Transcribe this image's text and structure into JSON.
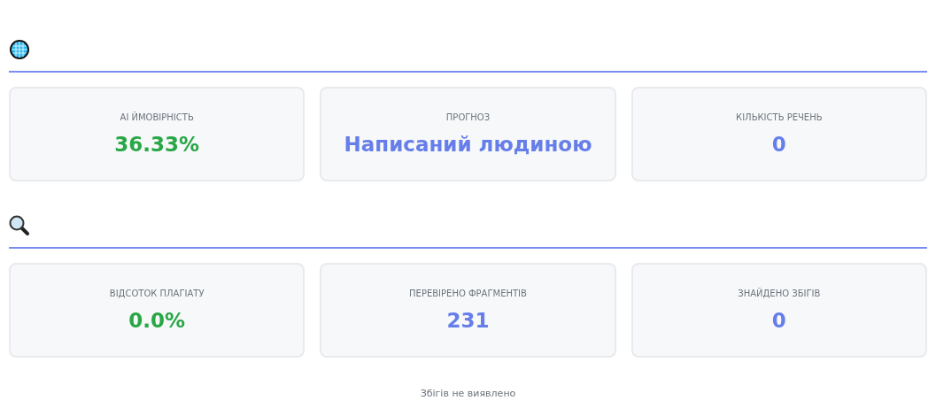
{
  "sections": [
    {
      "kind": "globe",
      "metrics": [
        {
          "label": "AI ЙМОВІРНІСТЬ",
          "value": "36.33%",
          "color": "#28a745"
        },
        {
          "label": "ПРОГНОЗ",
          "value": "Написаний людиною",
          "color": "#667eea"
        },
        {
          "label": "КІЛЬКІСТЬ РЕЧЕНЬ",
          "value": "0",
          "color": "#667eea"
        }
      ]
    },
    {
      "kind": "magnifier",
      "metrics": [
        {
          "label": "ВІДСОТОК ПЛАГІАТУ",
          "value": "0.0%",
          "color": "#28a745"
        },
        {
          "label": "ПЕРЕВІРЕНО ФРАГМЕНТІВ",
          "value": "231",
          "color": "#667eea"
        },
        {
          "label": "ЗНАЙДЕНО ЗБІГІВ",
          "value": "0",
          "color": "#667eea"
        }
      ]
    }
  ],
  "footer_note": "Збігів не виявлено"
}
